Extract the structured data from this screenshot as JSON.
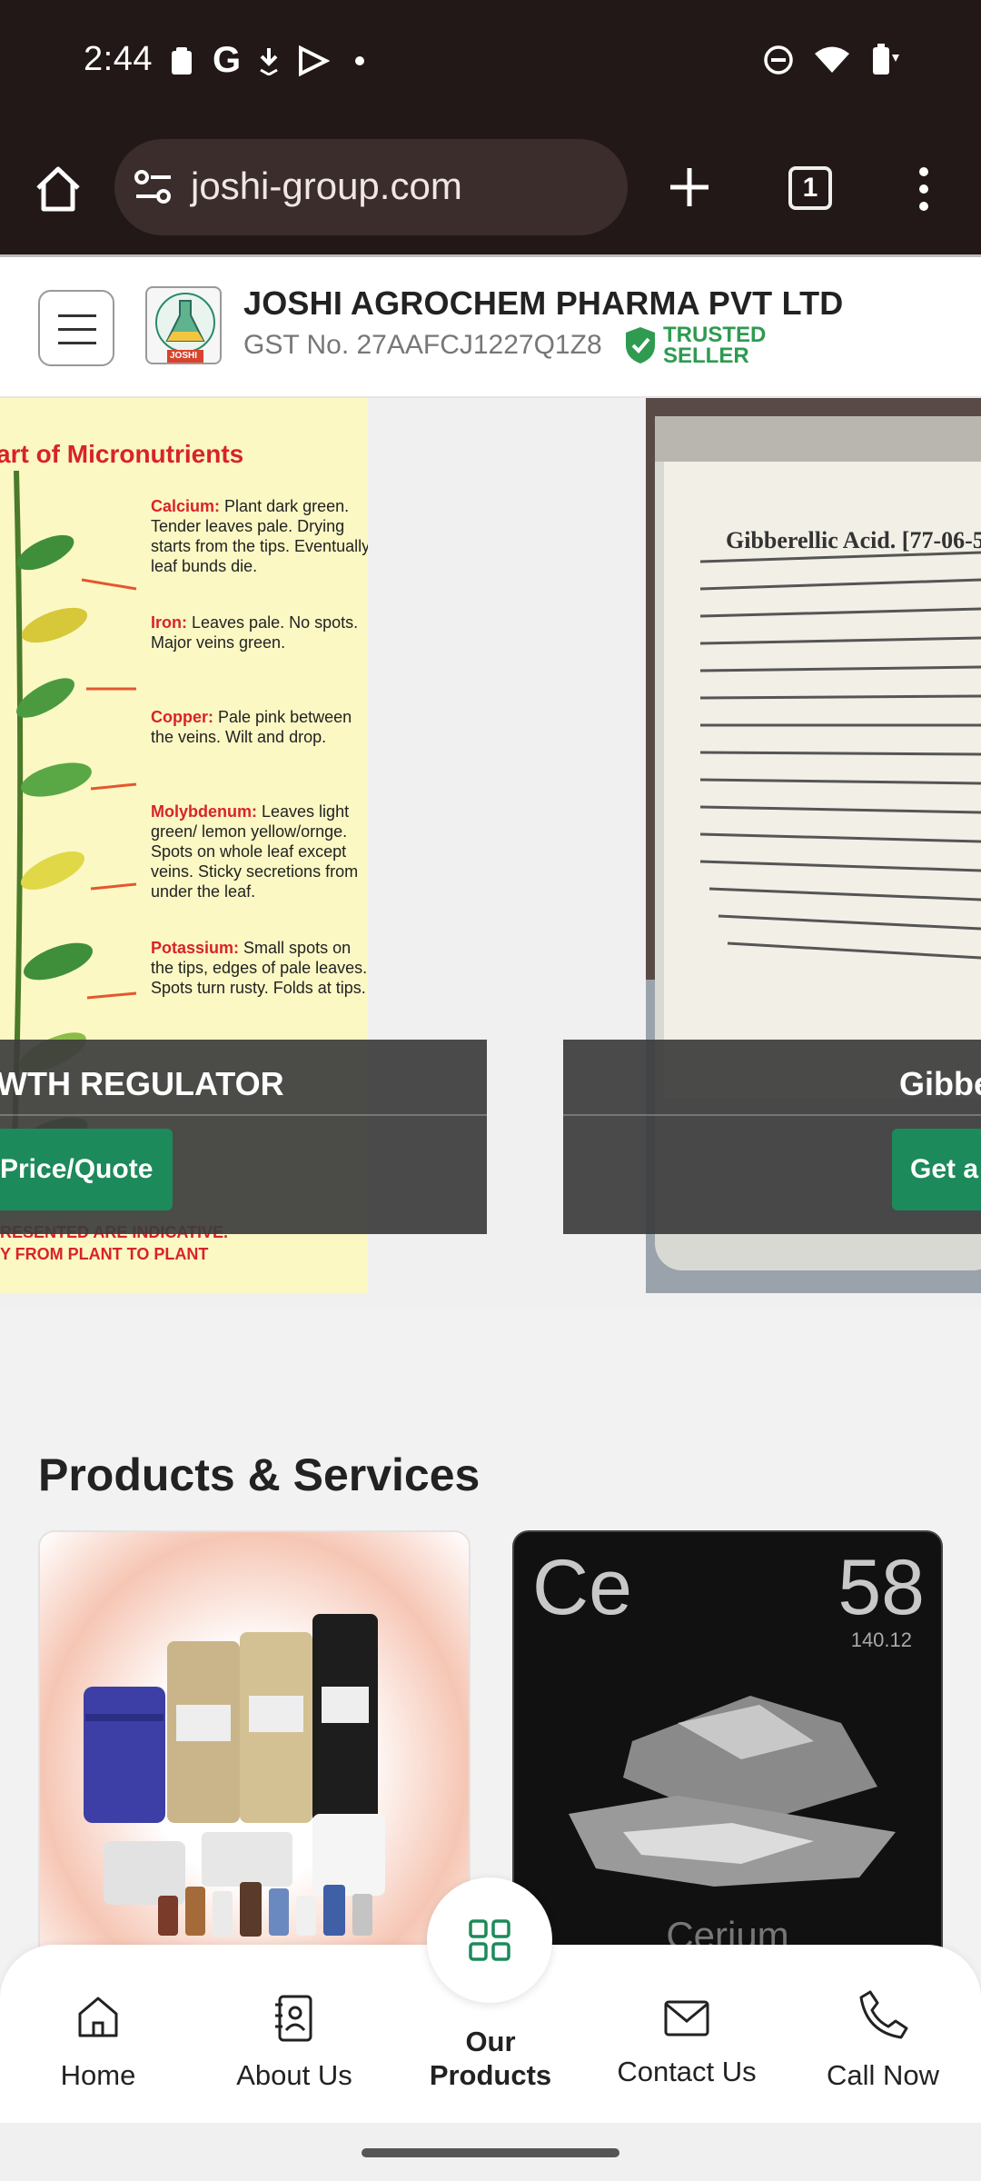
{
  "status_bar": {
    "time": "2:44"
  },
  "browser": {
    "url": "joshi-group.com",
    "tab_count": "1"
  },
  "header": {
    "company_name": "JOSHI AGROCHEM PHARMA PVT LTD",
    "gst": "GST No. 27AAFCJ1227Q1Z8",
    "trusted_line1": "TRUSTED",
    "trusted_line2": "SELLER",
    "logo_text": "JOSHI"
  },
  "carousel": {
    "active_index": 3,
    "dot_count": 4,
    "slide1": {
      "chart_title": "art of Micronutrients",
      "notes": [
        {
          "name": "Calcium:",
          "text": "Plant dark green. Tender leaves pale. Drying starts from the tips. Eventually leaf bunds die."
        },
        {
          "name": "Iron:",
          "text": "Leaves pale. No spots. Major veins green."
        },
        {
          "name": "Copper:",
          "text": "Pale pink between the veins. Wilt and drop."
        },
        {
          "name": "Molybdenum:",
          "text": "Leaves light green/ lemon yellow/ornge. Spots on whole leaf except veins. Sticky secretions from under the leaf."
        },
        {
          "name": "Potassium:",
          "text": "Small spots on the tips, edges of pale leaves. Spots turn rusty. Folds at tips."
        }
      ],
      "overlay_title": "WTH REGULATOR",
      "button_label": "Price/Quote",
      "footer_line1": "RESENTED ARE INDICATIVE.",
      "footer_line2": "Y FROM PLANT TO PLANT"
    },
    "slide2": {
      "label_title": "Gibberellic Acid. [77-06-5]",
      "overlay_title": "Gibbe",
      "button_label": "Get a"
    }
  },
  "products": {
    "section_title": "Products & Services",
    "card2": {
      "symbol": "Ce",
      "number": "58",
      "mass": "140.12",
      "name": "Cerium"
    }
  },
  "bottom_nav": {
    "home": "Home",
    "about": "About Us",
    "products_line1": "Our",
    "products_line2": "Products",
    "contact": "Contact Us",
    "call": "Call Now"
  },
  "colors": {
    "brand_green": "#1c8a5a",
    "chrome_dark": "#221817",
    "trusted_green": "#2e9b50"
  }
}
